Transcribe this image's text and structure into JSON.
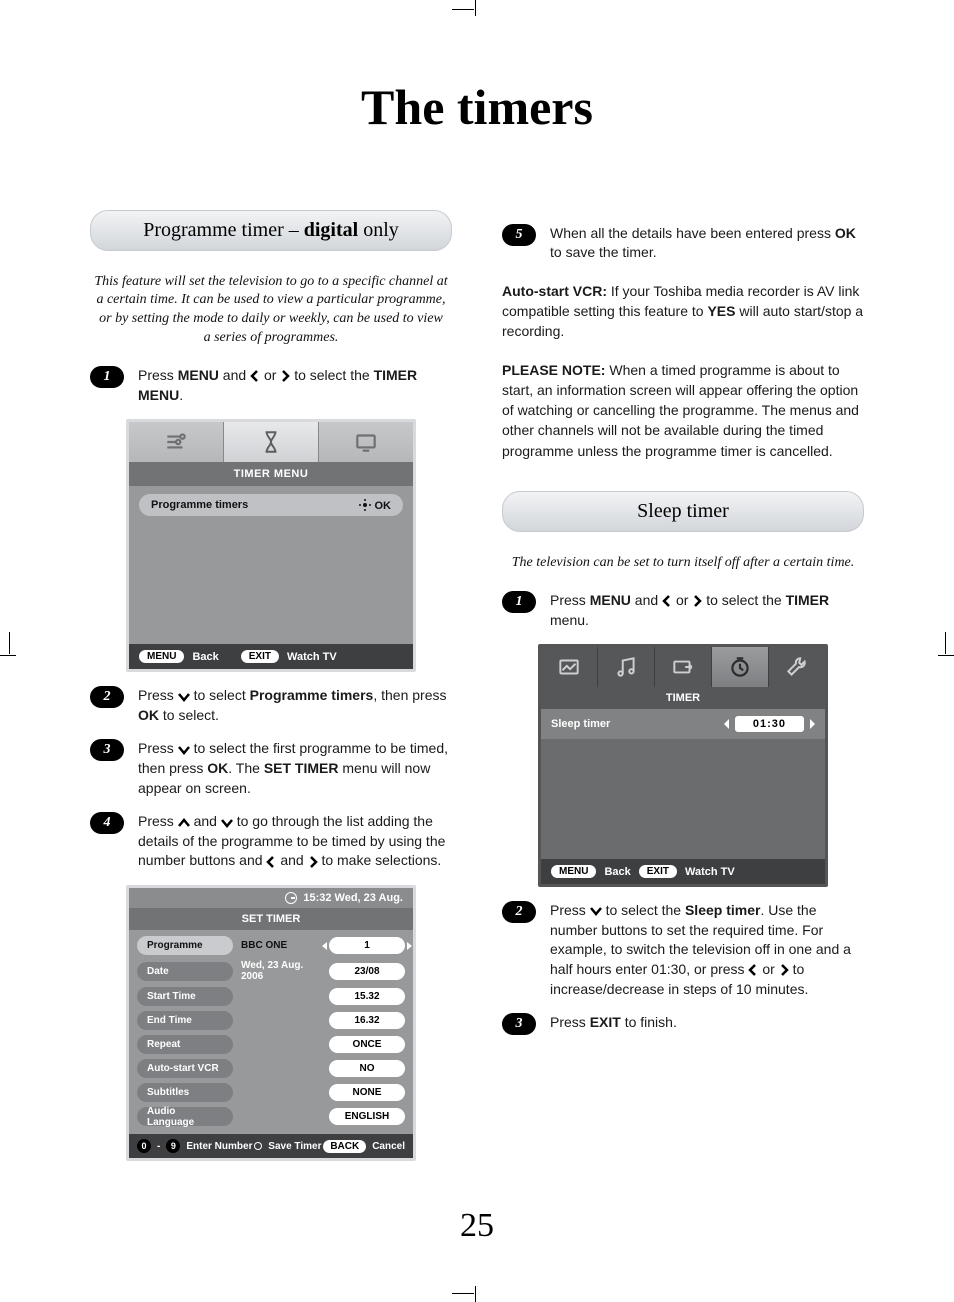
{
  "page_title": "The timers",
  "page_number": "25",
  "section_prog": {
    "prefix": "Programme timer – ",
    "bold": "digital",
    "suffix": " only"
  },
  "section_sleep": "Sleep timer",
  "intro_prog": "This feature will set the television to go to a specific channel at a certain time. It can be used to view a particular programme, or by setting the mode to daily or weekly, can be used to view a series of programmes.",
  "intro_sleep": "The television can be set to turn itself off after a certain time.",
  "steps_prog": {
    "1": {
      "a": "Press ",
      "b": "MENU",
      "c": " and ",
      "d": " or ",
      "e": " to select the ",
      "f": "TIMER MENU",
      "g": "."
    },
    "2": {
      "a": "Press ",
      "b": " to select ",
      "c": "Programme timers",
      "d": ", then press ",
      "e": "OK",
      "f": " to select."
    },
    "3": {
      "a": "Press ",
      "b": " to select the first programme to be timed, then press ",
      "c": "OK",
      "d": ". The ",
      "e": "SET TIMER",
      "f": " menu will now appear on screen."
    },
    "4": {
      "a": "Press ",
      "b": " and ",
      "c": " to go through the list adding the details of the programme to be timed by using the number buttons and ",
      "d": " and ",
      "e": " to make selections."
    }
  },
  "step5": {
    "a": "When all the details have been entered press ",
    "b": "OK",
    "c": " to save the timer."
  },
  "autostart": {
    "a": "Auto-start VCR:",
    "b": " If your Toshiba media recorder is AV link compatible setting this feature to ",
    "c": "YES",
    "d": " will auto start/stop a recording."
  },
  "pleasenote": {
    "a": "PLEASE NOTE:",
    "b": " When a timed programme is about to start, an information screen will appear offering the option of watching or cancelling the programme. The menus and other channels will not be available during the timed programme unless the programme timer is cancelled."
  },
  "steps_sleep": {
    "1": {
      "a": "Press ",
      "b": "MENU",
      "c": " and ",
      "d": " or ",
      "e": " to select the ",
      "f": "TIMER",
      "g": " menu."
    },
    "2": {
      "a": "Press ",
      "b": " to select the ",
      "c": "Sleep timer",
      "d": ". Use the number buttons to set the required time. For example, to switch the television off in one and a half hours enter 01:30, or press ",
      "e": " or ",
      "f": "  to increase/decrease in steps of 10 minutes."
    },
    "3": {
      "a": "Press ",
      "b": "EXIT",
      "c": " to finish."
    }
  },
  "osd_timer_menu": {
    "heading": "TIMER MENU",
    "row_label": "Programme timers",
    "row_action": "OK",
    "back_btn": "MENU",
    "back_label": "Back",
    "exit_btn": "EXIT",
    "exit_label": "Watch TV"
  },
  "osd_set_timer": {
    "clock": "15:32 Wed, 23 Aug.",
    "heading": "SET TIMER",
    "rows": [
      {
        "label": "Programme",
        "mid": "BBC ONE",
        "val": "1",
        "sel": true,
        "cap": true
      },
      {
        "label": "Date",
        "mid": "Wed, 23 Aug. 2006",
        "val": "23/08"
      },
      {
        "label": "Start Time",
        "mid": "",
        "val": "15.32"
      },
      {
        "label": "End Time",
        "mid": "",
        "val": "16.32"
      },
      {
        "label": "Repeat",
        "mid": "",
        "val": "ONCE"
      },
      {
        "label": "Auto-start VCR",
        "mid": "",
        "val": "NO"
      },
      {
        "label": "Subtitles",
        "mid": "",
        "val": "NONE"
      },
      {
        "label": "Audio Language",
        "mid": "",
        "val": "ENGLISH"
      }
    ],
    "foot_enter": "Enter Number",
    "foot_save": "Save Timer",
    "foot_back_btn": "BACK",
    "foot_cancel": "Cancel",
    "num_from": "0",
    "num_to": "9"
  },
  "osd_sleep": {
    "heading": "TIMER",
    "row_label": "Sleep timer",
    "row_value": "01:30",
    "back_btn": "MENU",
    "back_label": "Back",
    "exit_btn": "EXIT",
    "exit_label": "Watch TV"
  }
}
